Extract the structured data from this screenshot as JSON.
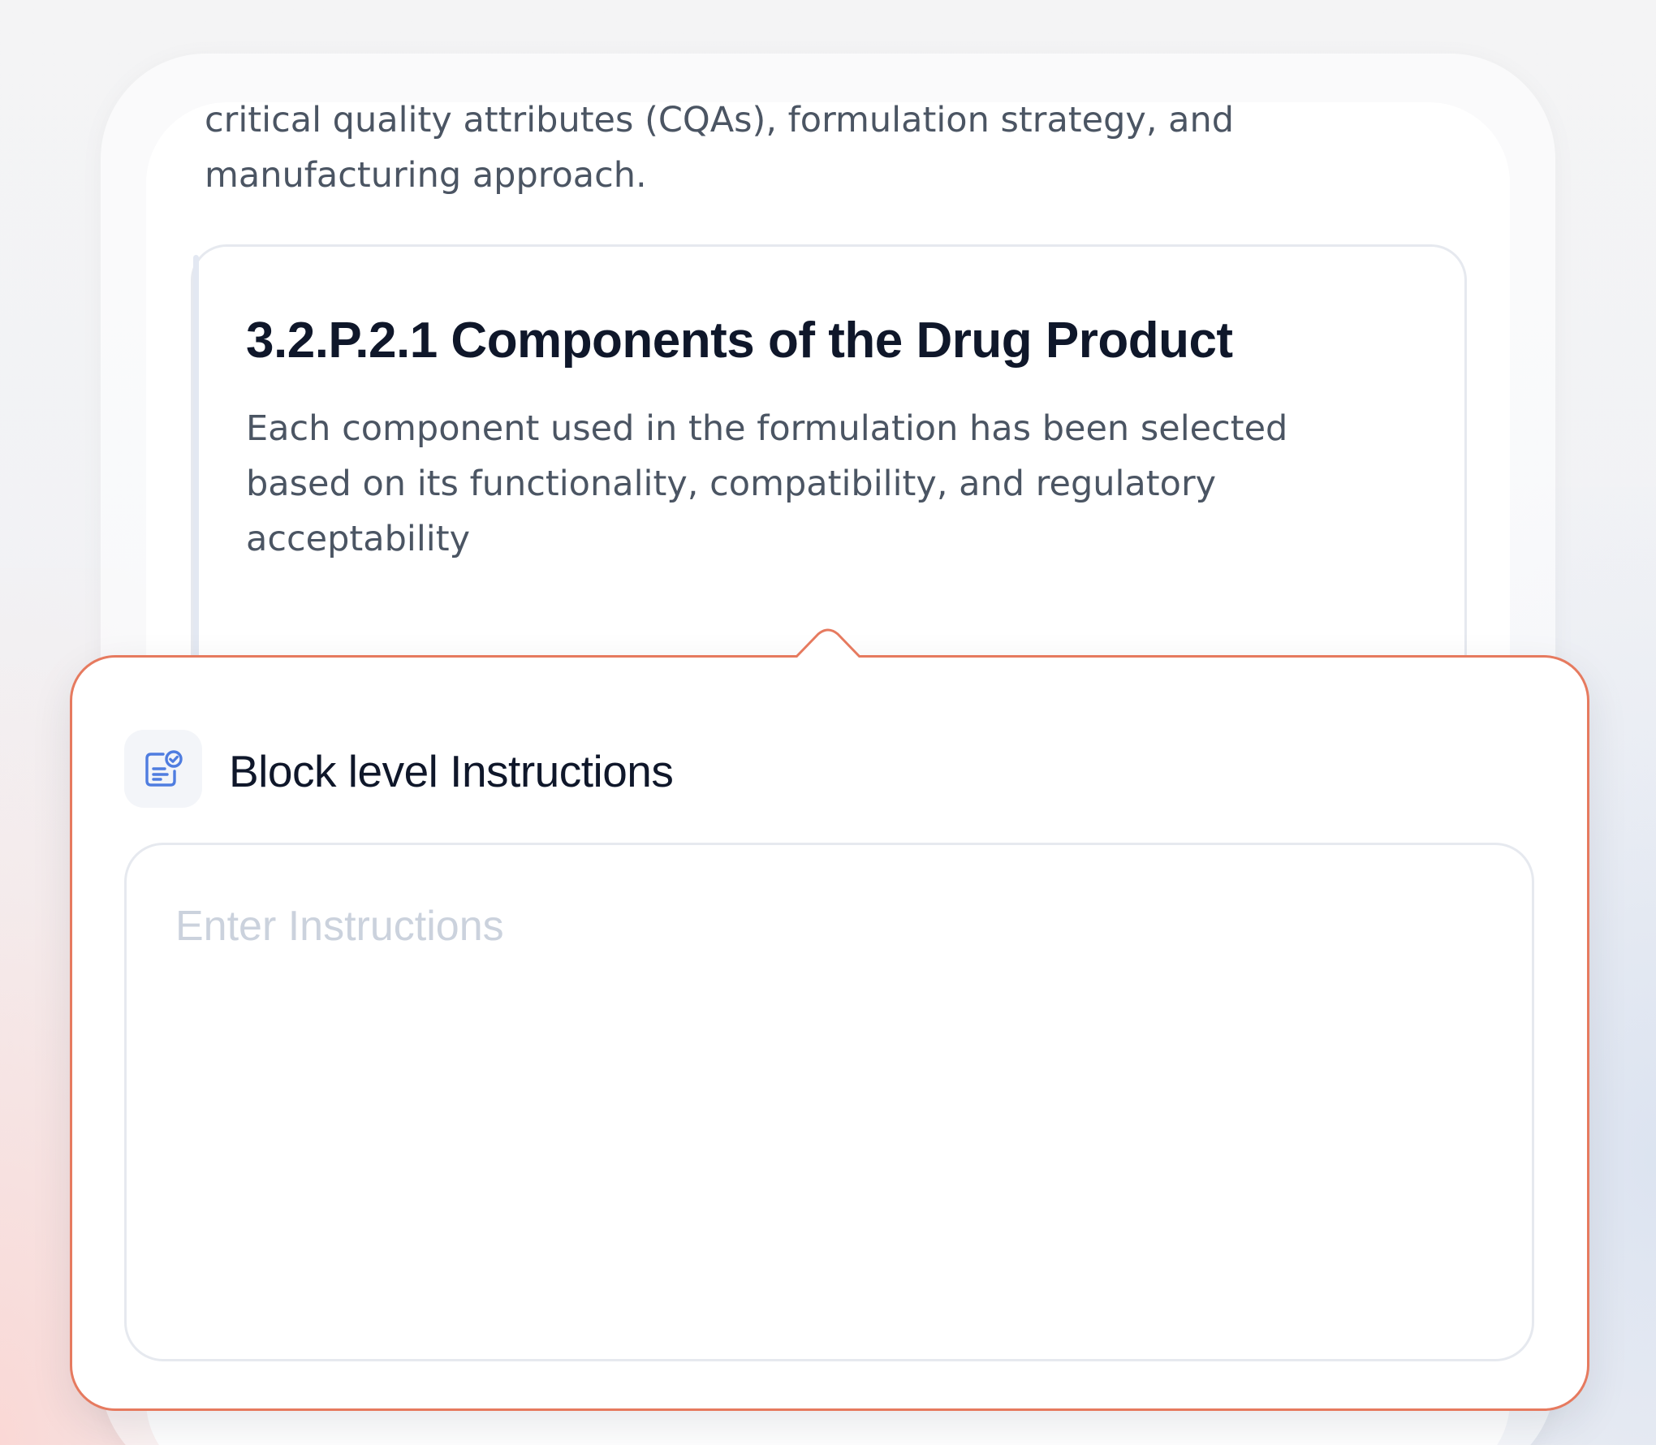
{
  "document": {
    "intro_line_1": "critical quality attributes (CQAs), formulation strategy, and",
    "intro_line_2": "manufacturing approach.",
    "section": {
      "title": "3.2.P.2.1 Components of the Drug Product",
      "body": "Each component used in the formulation has been selected based on its functionality, compatibility, and regulatory acceptability"
    }
  },
  "popover": {
    "icon": "clipboard-check-icon",
    "title": "Block level Instructions",
    "input": {
      "value": "",
      "placeholder": "Enter Instructions"
    }
  },
  "colors": {
    "popover_border": "#e67a5f",
    "icon_stroke": "#4f7de0",
    "heading_text": "#0f172a",
    "body_text": "#4b5563",
    "placeholder_text": "#cbd2dd"
  }
}
